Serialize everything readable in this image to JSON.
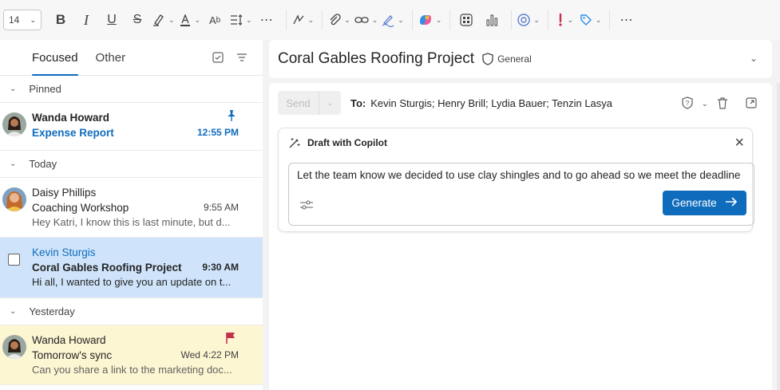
{
  "toolbar": {
    "font_size": "14",
    "buttons": [
      "bold-button",
      "italic-button",
      "underline-button",
      "strikethrough-button",
      "highlight-button",
      "font-color-button",
      "styles-button",
      "line-spacing-button",
      "more-format-button",
      "editor-button",
      "attach-button",
      "link-button",
      "signature-button",
      "copilot-button",
      "apps-button",
      "insights-button",
      "loop-button",
      "importance-button",
      "sensitivity-button",
      "more-options-button"
    ]
  },
  "tabs": {
    "focused": "Focused",
    "other": "Other"
  },
  "groups": {
    "pinned": "Pinned",
    "today": "Today",
    "yesterday": "Yesterday"
  },
  "messages": [
    {
      "sender": "Wanda Howard",
      "subject": "Expense Report",
      "time": "12:55 PM",
      "preview": "",
      "pinned": true
    },
    {
      "sender": "Daisy Phillips",
      "subject": "Coaching Workshop",
      "time": "9:55 AM",
      "preview": "Hey Katri, I know this is last minute, but d..."
    },
    {
      "sender": "Kevin Sturgis",
      "subject": "Coral Gables Roofing Project",
      "time": "9:30 AM",
      "preview": "Hi all, I wanted to give you an update on t...",
      "selected": true
    },
    {
      "sender": "Wanda Howard",
      "subject": "Tomorrow's sync",
      "time": "Wed 4:22 PM",
      "preview": "Can you share a link to the marketing doc...",
      "flagged": true
    }
  ],
  "reading": {
    "subject": "Coral Gables Roofing Project",
    "sensitivity": "General"
  },
  "compose": {
    "send_label": "Send",
    "to_label": "To:",
    "recipients": "Kevin Sturgis; Henry Brill; Lydia Bauer; Tenzin Lasya"
  },
  "copilot": {
    "title": "Draft with Copilot",
    "prompt": "Let the team know we decided to use clay shingles and to go ahead so we meet the deadline",
    "generate_label": "Generate"
  },
  "colors": {
    "accent": "#0f6cbd",
    "selected_bg": "#cfe4fa",
    "flag_bg": "#fdf6d3",
    "flag": "#c4314b"
  }
}
